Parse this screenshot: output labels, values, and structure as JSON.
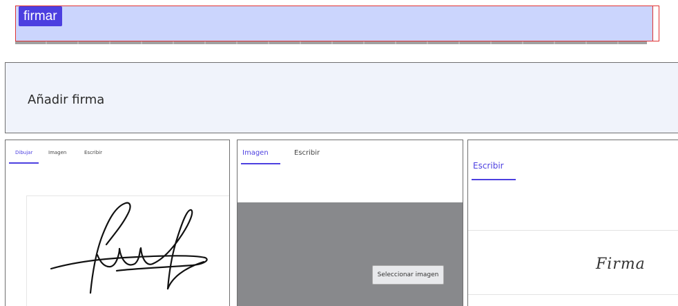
{
  "top_bar": {
    "button_label": "firmar"
  },
  "header": {
    "title": "Añadir firma"
  },
  "panel_draw": {
    "tabs": [
      "Dibujar",
      "Imagen",
      "Escribir"
    ],
    "active_tab": "Dibujar"
  },
  "panel_image": {
    "tabs": [
      "Imagen",
      "Escribir"
    ],
    "active_tab": "Imagen",
    "select_button": "Seleccionar imagen"
  },
  "panel_write": {
    "tabs": [
      "Escribir"
    ],
    "active_tab": "Escribir",
    "preview_text": "Firma"
  },
  "colors": {
    "accent": "#4c3fe0",
    "top_bar_bg": "#cbd5fd",
    "header_bg": "#f0f3fb",
    "image_area_bg": "#88898c"
  }
}
